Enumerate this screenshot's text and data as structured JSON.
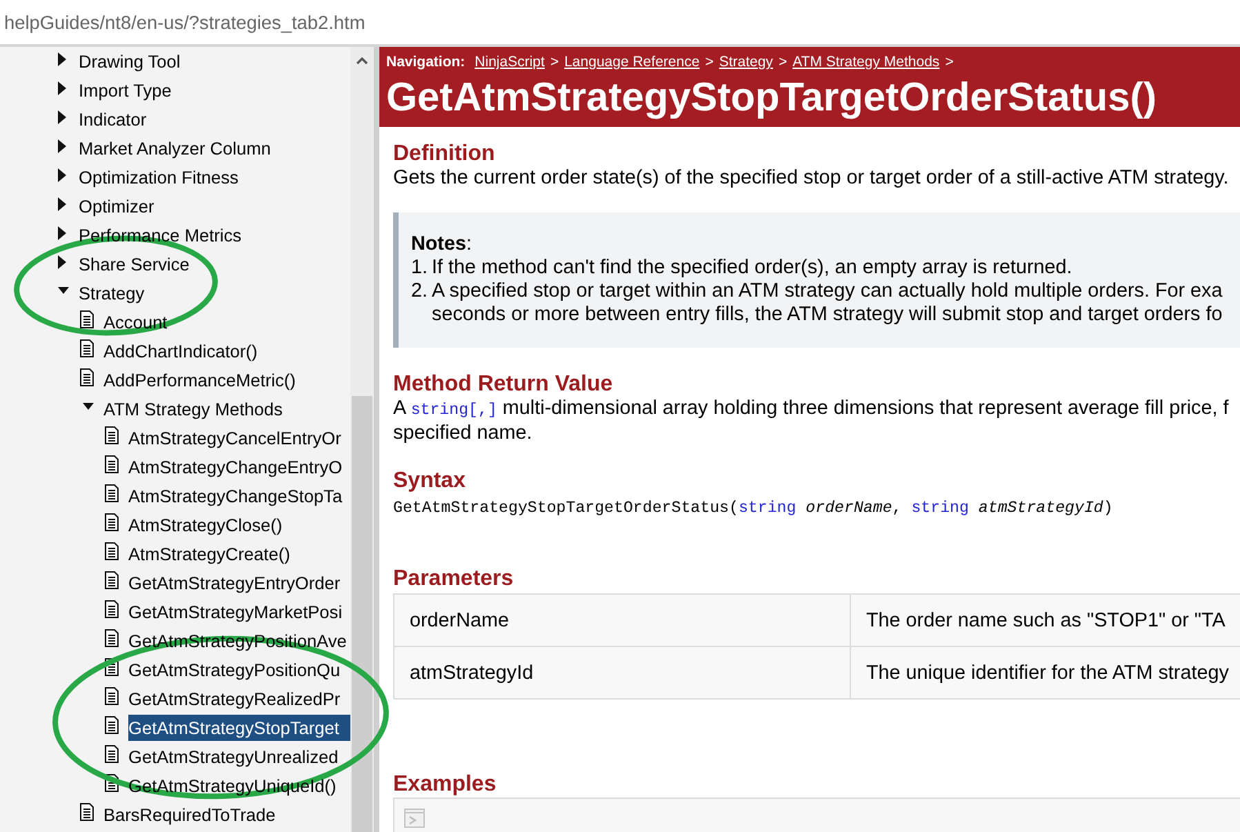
{
  "address_bar": {
    "value": "helpGuides/nt8/en-us/?strategies_tab2.htm"
  },
  "sidebar": {
    "tree": [
      {
        "kind": "folder",
        "label": "Drawing Tool",
        "expanded": false,
        "selected": false
      },
      {
        "kind": "folder",
        "label": "Import Type",
        "expanded": false,
        "selected": false
      },
      {
        "kind": "folder",
        "label": "Indicator",
        "expanded": false,
        "selected": false
      },
      {
        "kind": "folder",
        "label": "Market Analyzer Column",
        "expanded": false,
        "selected": false
      },
      {
        "kind": "folder",
        "label": "Optimization Fitness",
        "expanded": false,
        "selected": false
      },
      {
        "kind": "folder",
        "label": "Optimizer",
        "expanded": false,
        "selected": false
      },
      {
        "kind": "folder",
        "label": "Performance Metrics",
        "expanded": false,
        "selected": false
      },
      {
        "kind": "folder",
        "label": "Share Service",
        "expanded": false,
        "selected": false
      },
      {
        "kind": "folder",
        "label": "Strategy",
        "expanded": true,
        "selected": false,
        "children": [
          {
            "kind": "page",
            "label": "Account",
            "selected": false
          },
          {
            "kind": "page",
            "label": "AddChartIndicator()",
            "selected": false
          },
          {
            "kind": "page",
            "label": "AddPerformanceMetric()",
            "selected": false
          },
          {
            "kind": "folder",
            "label": "ATM Strategy Methods",
            "expanded": true,
            "selected": false,
            "children": [
              {
                "kind": "page",
                "label": "AtmStrategyCancelEntryOr",
                "selected": false
              },
              {
                "kind": "page",
                "label": "AtmStrategyChangeEntryO",
                "selected": false
              },
              {
                "kind": "page",
                "label": "AtmStrategyChangeStopTa",
                "selected": false
              },
              {
                "kind": "page",
                "label": "AtmStrategyClose()",
                "selected": false
              },
              {
                "kind": "page",
                "label": "AtmStrategyCreate()",
                "selected": false
              },
              {
                "kind": "page",
                "label": "GetAtmStrategyEntryOrder",
                "selected": false
              },
              {
                "kind": "page",
                "label": "GetAtmStrategyMarketPosi",
                "selected": false
              },
              {
                "kind": "page",
                "label": "GetAtmStrategyPositionAve",
                "selected": false
              },
              {
                "kind": "page",
                "label": "GetAtmStrategyPositionQu",
                "selected": false
              },
              {
                "kind": "page",
                "label": "GetAtmStrategyRealizedPr",
                "selected": false
              },
              {
                "kind": "page",
                "label": "GetAtmStrategyStopTarget",
                "selected": true
              },
              {
                "kind": "page",
                "label": "GetAtmStrategyUnrealized",
                "selected": false
              },
              {
                "kind": "page",
                "label": "GetAtmStrategyUniqueId()",
                "selected": false
              }
            ]
          },
          {
            "kind": "page",
            "label": "BarsRequiredToTrade",
            "selected": false
          }
        ]
      }
    ]
  },
  "header": {
    "navigation": {
      "label": "Navigation:",
      "items": [
        {
          "kind": "link",
          "text": "NinjaScript"
        },
        {
          "kind": "separator",
          "text": ">"
        },
        {
          "kind": "link",
          "text": "Language Reference"
        },
        {
          "kind": "separator",
          "text": ">"
        },
        {
          "kind": "link",
          "text": "Strategy"
        },
        {
          "kind": "separator",
          "text": ">"
        },
        {
          "kind": "link",
          "text": "ATM Strategy Methods"
        },
        {
          "kind": "separator",
          "text": ">"
        }
      ]
    },
    "title": "GetAtmStrategyStopTargetOrderStatus()"
  },
  "definition": {
    "heading": "Definition",
    "text": "Gets the current order state(s) of the specified stop or target order of a still-active ATM strategy."
  },
  "notes": {
    "title": "**Notes**:",
    "items": [
      {
        "number": "1.",
        "lines": [
          "If the method can't find the specified order(s), an empty array is returned."
        ]
      },
      {
        "number": "2.",
        "lines": [
          "A specified stop or target within an ATM strategy can actually hold multiple orders. For exa",
          "seconds or more between entry fills, the ATM strategy will submit stop and target orders fo"
        ]
      }
    ]
  },
  "return_value": {
    "heading": "Method Return Value",
    "lines": [
      [
        {
          "kind": "text",
          "text": "A "
        },
        {
          "kind": "code",
          "text": "string[,]"
        },
        {
          "kind": "text",
          "text": " multi-dimensional array holding three dimensions that represent average fill price, f"
        }
      ],
      [
        {
          "kind": "text",
          "text": "specified name."
        }
      ]
    ]
  },
  "syntax": {
    "heading": "Syntax",
    "parts": [
      {
        "kind": "plain",
        "text": "GetAtmStrategyStopTargetOrderStatus("
      },
      {
        "kind": "keyword",
        "text": "string "
      },
      {
        "kind": "param",
        "text": "orderName"
      },
      {
        "kind": "plain",
        "text": ", "
      },
      {
        "kind": "keyword",
        "text": "string "
      },
      {
        "kind": "param",
        "text": "atmStrategyId"
      },
      {
        "kind": "plain",
        "text": ")"
      }
    ]
  },
  "parameters": {
    "heading": "Parameters",
    "rows": [
      {
        "name": "orderName",
        "description": "The order name such as \"STOP1\" or \"TA"
      },
      {
        "name": "atmStrategyId",
        "description": "The unique identifier for the ATM strategy"
      }
    ]
  },
  "examples": {
    "heading": "Examples"
  },
  "annotations": [
    {
      "kind": "ellipse"
    },
    {
      "kind": "ellipse"
    }
  ]
}
